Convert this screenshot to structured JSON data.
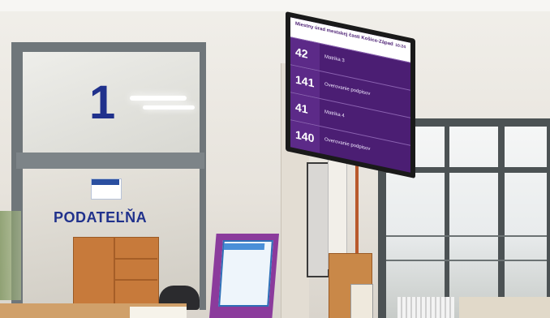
{
  "scene": {
    "window_number": "1",
    "window_sign": "PODATEĽŇA",
    "colors": {
      "sign_text": "#20318c",
      "screen_bg": "#4b1e73",
      "kiosk": "#8b3b9c"
    }
  },
  "queue_display": {
    "header": "Miestny úrad mestskej časti Košice-Západ",
    "time": "10:24",
    "rows": [
      {
        "number": "42",
        "label": "Matrika 3"
      },
      {
        "number": "141",
        "label": "Overovanie podpisov"
      },
      {
        "number": "41",
        "label": "Matrika 4"
      },
      {
        "number": "140",
        "label": "Overovanie podpisov"
      }
    ]
  }
}
